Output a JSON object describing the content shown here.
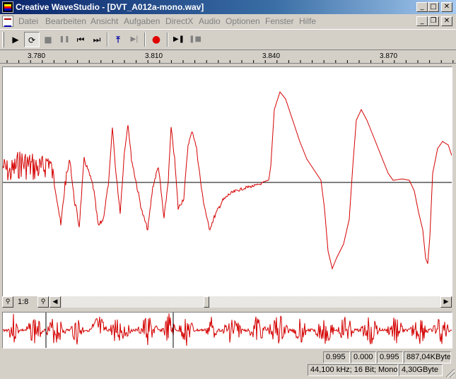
{
  "window": {
    "title": "Creative WaveStudio - [DVT_A012a-mono.wav]"
  },
  "menu": [
    "Datei",
    "Bearbeiten",
    "Ansicht",
    "Aufgaben",
    "DirectX",
    "Audio",
    "Optionen",
    "Fenster",
    "Hilfe"
  ],
  "toolbar": {
    "buttons": [
      {
        "name": "play-icon",
        "glyph": "▶",
        "enabled": true
      },
      {
        "name": "loop-play-icon",
        "glyph": "⟳",
        "enabled": true,
        "pressed": true
      },
      {
        "name": "stop-icon",
        "glyph": "■",
        "enabled": false
      },
      {
        "name": "pause-icon",
        "glyph": "❚❚",
        "enabled": false
      },
      {
        "name": "skip-start-icon",
        "glyph": "⏮",
        "enabled": true
      },
      {
        "name": "skip-end-icon",
        "glyph": "⏭",
        "enabled": true
      },
      {
        "name": "insert-marker-icon",
        "glyph": "⤒",
        "enabled": true
      },
      {
        "name": "play-to-marker-icon",
        "glyph": "▶|",
        "enabled": false
      },
      {
        "name": "record-icon",
        "glyph": "●",
        "enabled": true
      },
      {
        "name": "play-selection-icon",
        "glyph": "▶❚",
        "enabled": true
      },
      {
        "name": "stop-record-icon",
        "glyph": "❚■",
        "enabled": false
      }
    ]
  },
  "ruler": {
    "ticks": [
      "3.780",
      "3.810",
      "3.840",
      "3.870"
    ]
  },
  "zoom": {
    "level": "1:8"
  },
  "scroll": {
    "position": 0.38
  },
  "colors": {
    "waveform": "#d40000",
    "baseline": "#000000",
    "overview_cursor": "#000000"
  },
  "status": {
    "fields": [
      "0.995",
      "0.000",
      "0.995",
      "887,04KByte"
    ],
    "format": "44,100 kHz; 16 Bit; Mono",
    "disk": "4,30GByte"
  }
}
